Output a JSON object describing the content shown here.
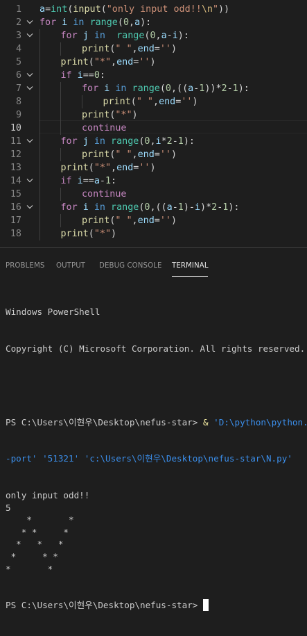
{
  "editor": {
    "active_line": 10,
    "lines": [
      {
        "n": "1",
        "fold": false,
        "indent": 0,
        "tokens": [
          [
            "vr",
            "a"
          ],
          [
            "pl",
            "="
          ],
          [
            "bi",
            "int"
          ],
          [
            "pl",
            "("
          ],
          [
            "fn",
            "input"
          ],
          [
            "pl",
            "("
          ],
          [
            "st",
            "\"only input odd!!"
          ],
          [
            "es",
            "\\n"
          ],
          [
            "st",
            "\""
          ],
          [
            "pl",
            "))"
          ]
        ]
      },
      {
        "n": "2",
        "fold": true,
        "indent": 0,
        "tokens": [
          [
            "kw",
            "for"
          ],
          [
            "pl",
            " "
          ],
          [
            "vr",
            "i"
          ],
          [
            "pl",
            " "
          ],
          [
            "kb",
            "in"
          ],
          [
            "pl",
            " "
          ],
          [
            "bi",
            "range"
          ],
          [
            "pl",
            "("
          ],
          [
            "nm",
            "0"
          ],
          [
            "pl",
            ","
          ],
          [
            "vr",
            "a"
          ],
          [
            "pl",
            "):"
          ]
        ]
      },
      {
        "n": "3",
        "fold": true,
        "indent": 1,
        "tokens": [
          [
            "kw",
            "for"
          ],
          [
            "pl",
            " "
          ],
          [
            "vr",
            "j"
          ],
          [
            "pl",
            " "
          ],
          [
            "kb",
            "in"
          ],
          [
            "pl",
            "  "
          ],
          [
            "bi",
            "range"
          ],
          [
            "pl",
            "("
          ],
          [
            "nm",
            "0"
          ],
          [
            "pl",
            ","
          ],
          [
            "vr",
            "a"
          ],
          [
            "pl",
            "-"
          ],
          [
            "vr",
            "i"
          ],
          [
            "pl",
            "):"
          ]
        ]
      },
      {
        "n": "4",
        "fold": false,
        "indent": 2,
        "tokens": [
          [
            "fn",
            "print"
          ],
          [
            "pl",
            "("
          ],
          [
            "st",
            "\" \""
          ],
          [
            "pl",
            ","
          ],
          [
            "vr",
            "end"
          ],
          [
            "pl",
            "="
          ],
          [
            "st",
            "''"
          ],
          [
            "pl",
            ")"
          ]
        ]
      },
      {
        "n": "5",
        "fold": false,
        "indent": 1,
        "tokens": [
          [
            "fn",
            "print"
          ],
          [
            "pl",
            "("
          ],
          [
            "st",
            "\"*\""
          ],
          [
            "pl",
            ","
          ],
          [
            "vr",
            "end"
          ],
          [
            "pl",
            "="
          ],
          [
            "st",
            "''"
          ],
          [
            "pl",
            ")"
          ]
        ]
      },
      {
        "n": "6",
        "fold": true,
        "indent": 1,
        "tokens": [
          [
            "kw",
            "if"
          ],
          [
            "pl",
            " "
          ],
          [
            "vr",
            "i"
          ],
          [
            "pl",
            "=="
          ],
          [
            "nm",
            "0"
          ],
          [
            "pl",
            ":"
          ]
        ]
      },
      {
        "n": "7",
        "fold": true,
        "indent": 2,
        "tokens": [
          [
            "kw",
            "for"
          ],
          [
            "pl",
            " "
          ],
          [
            "vr",
            "i"
          ],
          [
            "pl",
            " "
          ],
          [
            "kb",
            "in"
          ],
          [
            "pl",
            " "
          ],
          [
            "bi",
            "range"
          ],
          [
            "pl",
            "("
          ],
          [
            "nm",
            "0"
          ],
          [
            "pl",
            ",(("
          ],
          [
            "vr",
            "a"
          ],
          [
            "pl",
            "-"
          ],
          [
            "nm",
            "1"
          ],
          [
            "pl",
            "))*"
          ],
          [
            "nm",
            "2"
          ],
          [
            "pl",
            "-"
          ],
          [
            "nm",
            "1"
          ],
          [
            "pl",
            "):"
          ]
        ]
      },
      {
        "n": "8",
        "fold": false,
        "indent": 3,
        "tokens": [
          [
            "fn",
            "print"
          ],
          [
            "pl",
            "("
          ],
          [
            "st",
            "\" \""
          ],
          [
            "pl",
            ","
          ],
          [
            "vr",
            "end"
          ],
          [
            "pl",
            "="
          ],
          [
            "st",
            "''"
          ],
          [
            "pl",
            ")"
          ]
        ]
      },
      {
        "n": "9",
        "fold": false,
        "indent": 2,
        "tokens": [
          [
            "fn",
            "print"
          ],
          [
            "pl",
            "("
          ],
          [
            "st",
            "\"*\""
          ],
          [
            "pl",
            ")"
          ]
        ]
      },
      {
        "n": "10",
        "fold": false,
        "indent": 2,
        "tokens": [
          [
            "kw",
            "continue"
          ]
        ]
      },
      {
        "n": "11",
        "fold": true,
        "indent": 1,
        "tokens": [
          [
            "kw",
            "for"
          ],
          [
            "pl",
            " "
          ],
          [
            "vr",
            "j"
          ],
          [
            "pl",
            " "
          ],
          [
            "kb",
            "in"
          ],
          [
            "pl",
            " "
          ],
          [
            "bi",
            "range"
          ],
          [
            "pl",
            "("
          ],
          [
            "nm",
            "0"
          ],
          [
            "pl",
            ","
          ],
          [
            "vr",
            "i"
          ],
          [
            "pl",
            "*"
          ],
          [
            "nm",
            "2"
          ],
          [
            "pl",
            "-"
          ],
          [
            "nm",
            "1"
          ],
          [
            "pl",
            "):"
          ]
        ]
      },
      {
        "n": "12",
        "fold": false,
        "indent": 2,
        "tokens": [
          [
            "fn",
            "print"
          ],
          [
            "pl",
            "("
          ],
          [
            "st",
            "\" \""
          ],
          [
            "pl",
            ","
          ],
          [
            "vr",
            "end"
          ],
          [
            "pl",
            "="
          ],
          [
            "st",
            "''"
          ],
          [
            "pl",
            ")"
          ]
        ]
      },
      {
        "n": "13",
        "fold": false,
        "indent": 1,
        "tokens": [
          [
            "fn",
            "print"
          ],
          [
            "pl",
            "("
          ],
          [
            "st",
            "\"*\""
          ],
          [
            "pl",
            ","
          ],
          [
            "vr",
            "end"
          ],
          [
            "pl",
            "="
          ],
          [
            "st",
            "''"
          ],
          [
            "pl",
            ")"
          ]
        ]
      },
      {
        "n": "14",
        "fold": true,
        "indent": 1,
        "tokens": [
          [
            "kw",
            "if"
          ],
          [
            "pl",
            " "
          ],
          [
            "vr",
            "i"
          ],
          [
            "pl",
            "=="
          ],
          [
            "vr",
            "a"
          ],
          [
            "pl",
            "-"
          ],
          [
            "nm",
            "1"
          ],
          [
            "pl",
            ":"
          ]
        ]
      },
      {
        "n": "15",
        "fold": false,
        "indent": 2,
        "tokens": [
          [
            "kw",
            "continue"
          ]
        ]
      },
      {
        "n": "16",
        "fold": true,
        "indent": 1,
        "tokens": [
          [
            "kw",
            "for"
          ],
          [
            "pl",
            " "
          ],
          [
            "vr",
            "i"
          ],
          [
            "pl",
            " "
          ],
          [
            "kb",
            "in"
          ],
          [
            "pl",
            " "
          ],
          [
            "bi",
            "range"
          ],
          [
            "pl",
            "("
          ],
          [
            "nm",
            "0"
          ],
          [
            "pl",
            ",(("
          ],
          [
            "vr",
            "a"
          ],
          [
            "pl",
            "-"
          ],
          [
            "nm",
            "1"
          ],
          [
            "pl",
            ")-"
          ],
          [
            "vr",
            "i"
          ],
          [
            "pl",
            ")*"
          ],
          [
            "nm",
            "2"
          ],
          [
            "pl",
            "-"
          ],
          [
            "nm",
            "1"
          ],
          [
            "pl",
            "):"
          ]
        ]
      },
      {
        "n": "17",
        "fold": false,
        "indent": 2,
        "tokens": [
          [
            "fn",
            "print"
          ],
          [
            "pl",
            "("
          ],
          [
            "st",
            "\" \""
          ],
          [
            "pl",
            ","
          ],
          [
            "vr",
            "end"
          ],
          [
            "pl",
            "="
          ],
          [
            "st",
            "''"
          ],
          [
            "pl",
            ")"
          ]
        ]
      },
      {
        "n": "18",
        "fold": false,
        "indent": 1,
        "tokens": [
          [
            "fn",
            "print"
          ],
          [
            "pl",
            "("
          ],
          [
            "st",
            "\"*\""
          ],
          [
            "pl",
            ")"
          ]
        ]
      }
    ]
  },
  "panel": {
    "tabs": [
      {
        "label": "PROBLEMS",
        "active": false
      },
      {
        "label": "OUTPUT",
        "active": false
      },
      {
        "label": "DEBUG CONSOLE",
        "active": false
      },
      {
        "label": "TERMINAL",
        "active": true
      }
    ]
  },
  "terminal": {
    "header1": "Windows PowerShell",
    "header2": "Copyright (C) Microsoft Corporation. All rights reserved.",
    "prompt": "PS C:\\Users\\이현우\\Desktop\\nefus-star>",
    "cmd_amp": "&",
    "cmd_path": "'D:\\python\\python.exe",
    "cmd_cont": "-port' '51321' 'c:\\Users\\이현우\\Desktop\\nefus-star\\N.py'",
    "output": [
      "only input odd!!",
      "5",
      "    *       *",
      "   * *     *",
      "  *   *   *",
      " *     * *",
      "*       *"
    ],
    "final_prompt": "PS C:\\Users\\이현우\\Desktop\\nefus-star>"
  },
  "colors": {
    "keyword": "#c586c0",
    "builtin": "#4ec9b0",
    "function": "#dcdcaa",
    "string": "#ce9178",
    "number": "#b5cea8",
    "variable": "#9cdcfe",
    "terminal_path": "#3b8eea"
  }
}
